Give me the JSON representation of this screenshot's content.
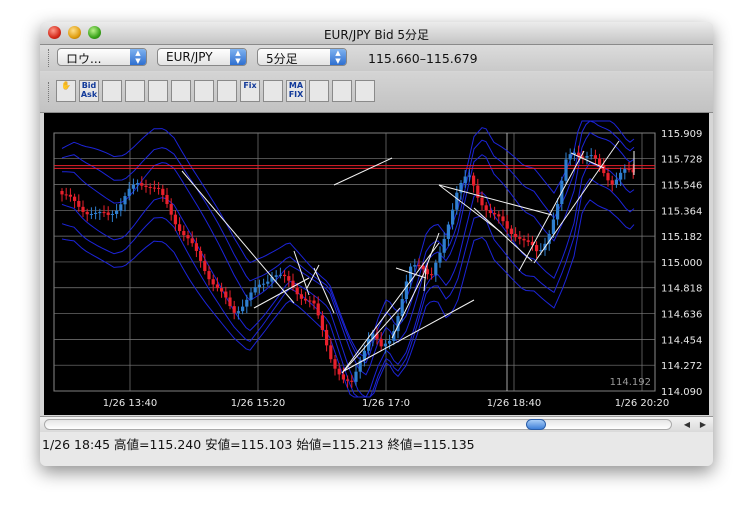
{
  "window": {
    "title": "EUR/JPY Bid 5分足"
  },
  "toolbar": {
    "mode_select": "ロウ...",
    "pair_select": "EUR/JPY",
    "period_select": "5分足",
    "price_range": "115.660–115.679"
  },
  "tools": [
    {
      "icon": "hand-icon",
      "label": "✋"
    },
    {
      "icon": "bid-ask-icon",
      "label": "Bid Ask"
    },
    {
      "icon": "line-chart-icon",
      "label": ""
    },
    {
      "icon": "wave-chart-icon",
      "label": ""
    },
    {
      "icon": "candle-chart-icon",
      "label": ""
    },
    {
      "icon": "candle-red-green-icon",
      "label": ""
    },
    {
      "icon": "candle-pair-icon",
      "label": ""
    },
    {
      "icon": "candle-red-icon",
      "label": ""
    },
    {
      "icon": "fix-icon",
      "label": "Fix"
    },
    {
      "icon": "grid-chart-icon",
      "label": ""
    },
    {
      "icon": "ma-fix-icon",
      "label": "MA FIX"
    },
    {
      "icon": "bars-color-icon",
      "label": ""
    },
    {
      "icon": "pencil-icon",
      "label": ""
    },
    {
      "icon": "eraser-icon",
      "label": ""
    }
  ],
  "chart_data": {
    "type": "candlestick",
    "y_ticks": [
      "115.909",
      "115.728",
      "115.546",
      "115.364",
      "115.182",
      "115.000",
      "114.818",
      "114.636",
      "114.454",
      "114.272",
      "114.090"
    ],
    "y_values": [
      115.909,
      115.728,
      115.546,
      115.364,
      115.182,
      115.0,
      114.818,
      114.636,
      114.454,
      114.272,
      114.09
    ],
    "ylim": [
      114.09,
      115.909
    ],
    "x_ticks": [
      "1/26 13:40",
      "1/26 15:20",
      "1/26 17:0",
      "1/26 18:40",
      "1/26 20:20"
    ],
    "low_label": "114.192",
    "red_line_values": [
      115.679,
      115.66
    ],
    "colors": {
      "up": "#2f7fd0",
      "down": "#e8202c",
      "band": "#1c24d8",
      "grid": "#ffffff",
      "background": "#000000"
    }
  },
  "status": {
    "text": "1/26 18:45  高値=115.240 安値=115.103 始値=115.213 終値=115.135"
  }
}
